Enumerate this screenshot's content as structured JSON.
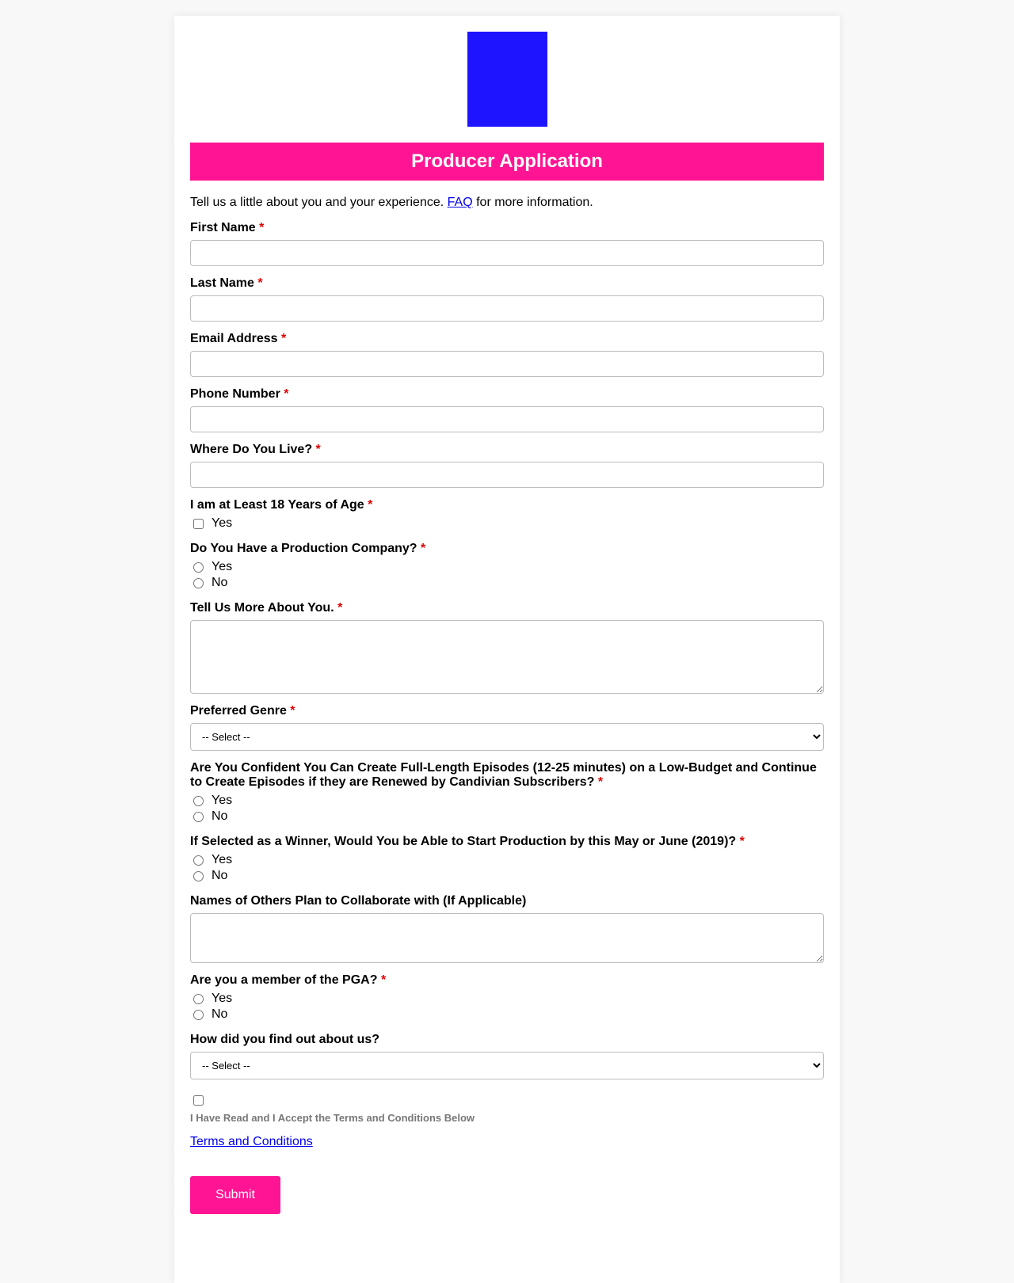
{
  "colors": {
    "accent": "#ff1493",
    "logo": "#1f14ff"
  },
  "form": {
    "title": "Producer Application",
    "intro_before": "Tell us a little about you and your experience. ",
    "intro_link": "FAQ",
    "intro_after": " for more information.",
    "required_marker": "*",
    "first_name_label": "First Name",
    "last_name_label": "Last Name",
    "email_label": "Email Address",
    "phone_label": "Phone Number",
    "live_label": "Where Do You Live?",
    "age_label": "I am at Least 18 Years of Age",
    "age_option": "Yes",
    "company_label": "Do You Have a Production Company?",
    "more_label": "Tell Us More About You.",
    "genre_label": "Preferred Genre",
    "genre_selected": "-- Select --",
    "confident_label": "Are You Confident You Can Create Full-Length Episodes (12-25 minutes) on a Low-Budget and Continue to Create Episodes if they are Renewed by Candivian Subscribers?",
    "winner_label": "If Selected as a Winner, Would You be Able to Start Production by this May or June (2019)?",
    "collab_label": "Names of Others Plan to Collaborate with (If Applicable)",
    "pga_label": "Are you a member of the PGA?",
    "find_label": "How did you find out about us?",
    "find_selected": "-- Select --",
    "yes": "Yes",
    "no": "No",
    "terms_accept": "I Have Read and I Accept the Terms and Conditions Below",
    "terms_link": "Terms and Conditions",
    "submit": "Submit"
  }
}
